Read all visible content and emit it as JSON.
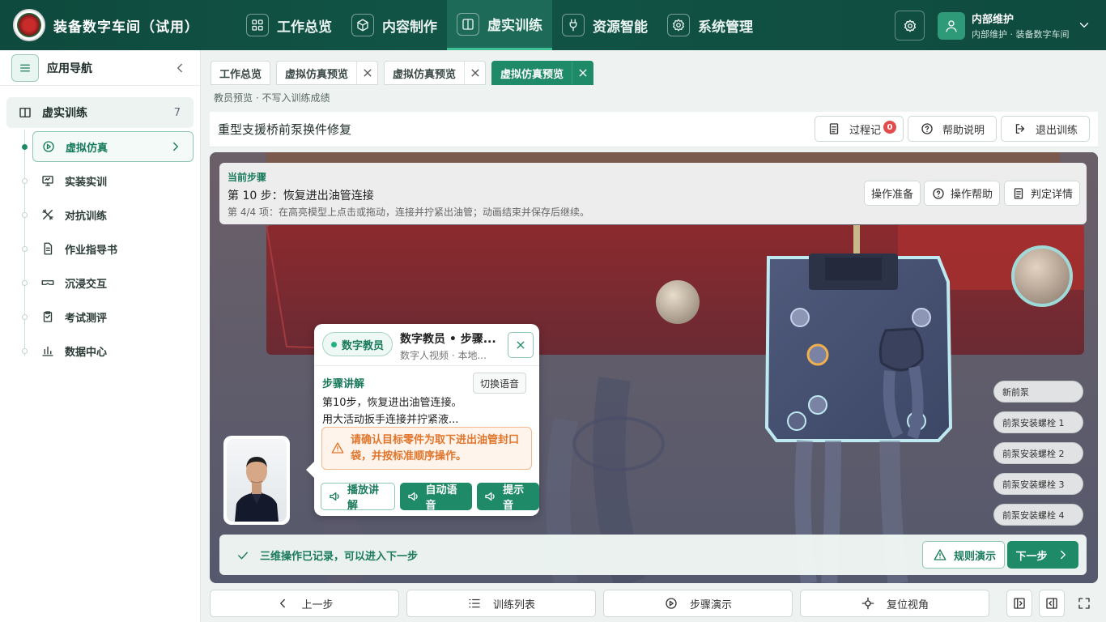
{
  "app": {
    "title": "装备数字车间（试用）"
  },
  "nav": [
    {
      "label": "工作总览",
      "icon": "grid-icon",
      "active": false
    },
    {
      "label": "内容制作",
      "icon": "cube-icon",
      "active": false
    },
    {
      "label": "虚实训练",
      "icon": "book-icon",
      "active": true
    },
    {
      "label": "资源智能",
      "icon": "plug-icon",
      "active": false
    },
    {
      "label": "系统管理",
      "icon": "gear-icon",
      "active": false
    }
  ],
  "user": {
    "name": "内部维护",
    "subtitle": "内部维护 · 装备数字车间"
  },
  "sidebar": {
    "title": "应用导航",
    "group": {
      "label": "虚实训练",
      "count": "7"
    },
    "items": [
      {
        "label": "虚拟仿真",
        "icon": "play-circle-icon"
      },
      {
        "label": "实装实训",
        "icon": "monitor-icon"
      },
      {
        "label": "对抗训练",
        "icon": "sword-icon"
      },
      {
        "label": "作业指导书",
        "icon": "file-icon"
      },
      {
        "label": "沉浸交互",
        "icon": "vr-goggles-icon"
      },
      {
        "label": "考试测评",
        "icon": "clipboard-icon"
      },
      {
        "label": "数据中心",
        "icon": "chart-icon"
      }
    ]
  },
  "tabs": [
    {
      "label": "工作总览",
      "closable": false
    },
    {
      "label": "虚拟仿真预览",
      "closable": true
    },
    {
      "label": "虚拟仿真预览",
      "closable": true
    },
    {
      "label": "虚拟仿真预览",
      "closable": true,
      "active": true
    }
  ],
  "page": {
    "hint": "教员预览 · 不写入训练成绩",
    "title": "重型支援桥前泵换件修复",
    "process_label": "过程记",
    "process_badge": "0",
    "help_label": "帮助说明",
    "exit_label": "退出训练"
  },
  "step": {
    "label": "当前步骤",
    "title": "第 10 步：恢复进出油管连接",
    "desc": "第 4/4 项：在高亮模型上点击或拖动，连接并拧紧出油管；动画结束并保存后继续。",
    "buttons": [
      "操作准备",
      "操作帮助",
      "判定详情"
    ]
  },
  "parts": [
    "新前泵",
    "前泵安装螺栓 1",
    "前泵安装螺栓 2",
    "前泵安装螺栓 3",
    "前泵安装螺栓 4"
  ],
  "teacher": {
    "tag": "数字教员",
    "name": "数字教员 • 步骤...",
    "sub": "数字人视频 · 本地...",
    "section": "步骤讲解",
    "switch": "切换语音",
    "line1": "第10步，恢复进出油管连接。",
    "line2": "用大活动扳手连接并拧紧液...",
    "warning": "请确认目标零件为取下进出油管封口袋，并按标准顺序操作。",
    "actions": [
      "播放讲解",
      "自动语音",
      "提示音"
    ]
  },
  "status": {
    "text": "三维操作已记录，可以进入下一步",
    "rule": "规则演示",
    "next": "下一步"
  },
  "bottom": [
    "上一步",
    "训练列表",
    "步骤演示",
    "复位视角"
  ],
  "colors": {
    "primary": "#1f8a68",
    "header": "#115446",
    "warning": "#e0762c",
    "badge": "#e24c4c"
  }
}
